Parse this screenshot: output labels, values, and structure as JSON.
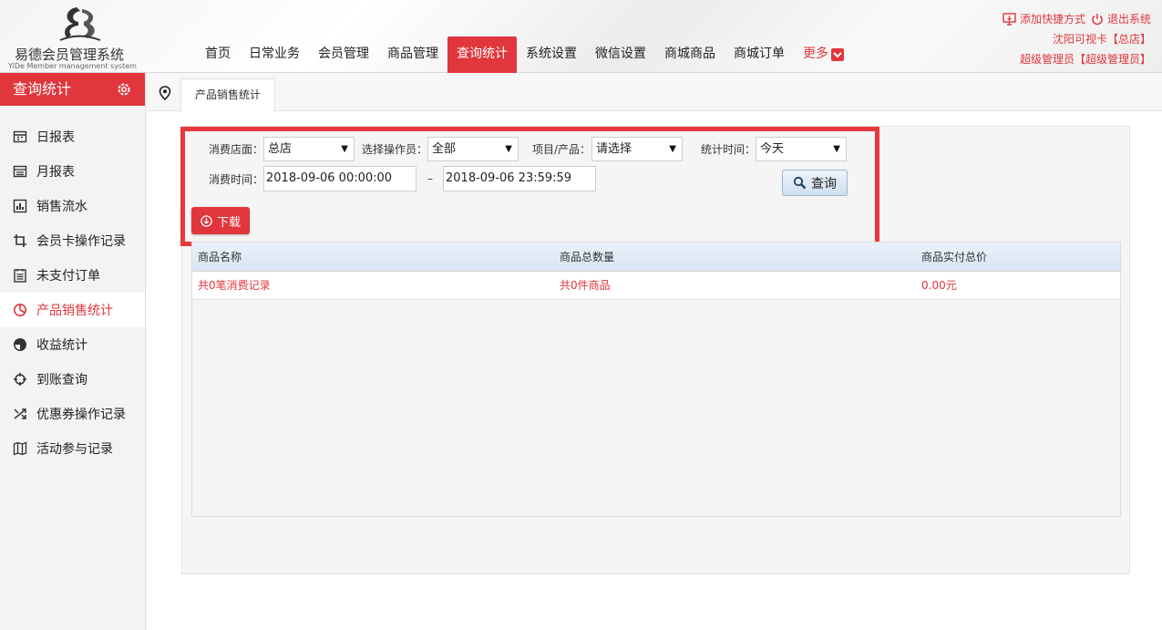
{
  "header": {
    "logo_title": "易德会员管理系统",
    "logo_subtitle": "YiDe Member management system",
    "nav": [
      "首页",
      "日常业务",
      "会员管理",
      "商品管理",
      "查询统计",
      "系统设置",
      "微信设置",
      "商城商品",
      "商城订单"
    ],
    "nav_active": "查询统计",
    "more_label": "更多",
    "add_shortcut": "添加快捷方式",
    "logout": "退出系统",
    "store_line": "沈阳可视卡【总店】",
    "user_line": "超级管理员【超级管理员】"
  },
  "sidebar": {
    "title": "查询统计",
    "items": [
      {
        "label": "日报表",
        "icon": "calendar-icon"
      },
      {
        "label": "月报表",
        "icon": "calendar-month-icon"
      },
      {
        "label": "销售流水",
        "icon": "bar-chart-icon"
      },
      {
        "label": "会员卡操作记录",
        "icon": "crop-icon"
      },
      {
        "label": "未支付订单",
        "icon": "order-list-icon"
      },
      {
        "label": "产品销售统计",
        "icon": "pie-chart-icon"
      },
      {
        "label": "收益统计",
        "icon": "half-circle-icon"
      },
      {
        "label": "到账查询",
        "icon": "crosshair-icon"
      },
      {
        "label": "优惠券操作记录",
        "icon": "shuffle-icon"
      },
      {
        "label": "活动参与记录",
        "icon": "map-icon"
      }
    ],
    "active": "产品销售统计"
  },
  "tab": {
    "label": "产品销售统计"
  },
  "filters": {
    "store_label": "消费店面：",
    "store_value": "总店",
    "operator_label": "选择操作员：",
    "operator_value": "全部",
    "product_label": "项目/产品：",
    "product_value": "请选择",
    "period_label": "统计时间：",
    "period_value": "今天",
    "time_label": "消费时间：",
    "time_start": "2018-09-06 00:00:00",
    "time_sep": "–",
    "time_end": "2018-09-06 23:59:59",
    "query_label": "查询",
    "download_label": "下载"
  },
  "table": {
    "columns": [
      "商品名称",
      "商品总数量",
      "商品实付总价"
    ],
    "summary": [
      "共0笔消费记录",
      "共0件商品",
      "0.00元"
    ]
  },
  "colors": {
    "accent": "#e0363c",
    "highlight_border": "#e8383d"
  }
}
